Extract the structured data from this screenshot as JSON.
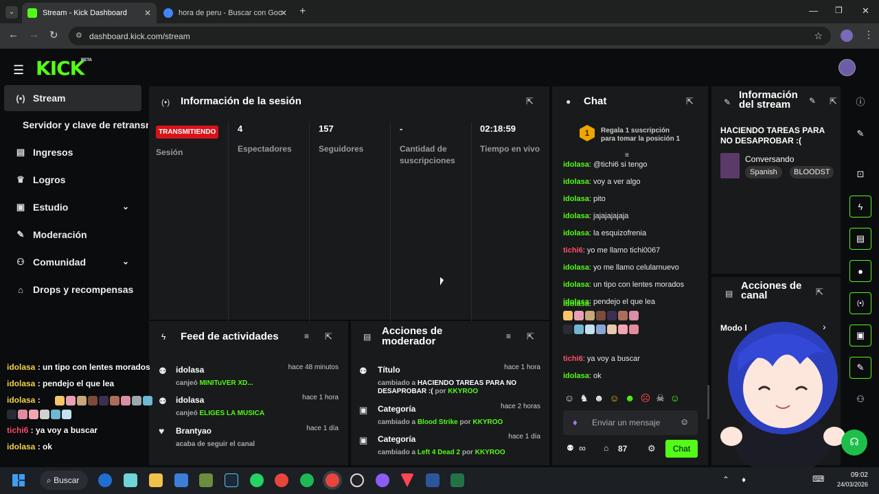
{
  "browser": {
    "tabs": [
      {
        "title": "Stream - Kick Dashboard",
        "active": true
      },
      {
        "title": "hora de peru - Buscar con Goo",
        "active": false
      }
    ],
    "url": "dashboard.kick.com/stream"
  },
  "header": {
    "logo": "KICK",
    "beta": "BETA"
  },
  "sidebar": {
    "items": [
      {
        "label": "Stream",
        "icon": "broadcast-icon",
        "active": true
      },
      {
        "label": "Servidor y clave de retransm",
        "icon": ""
      },
      {
        "label": "Ingresos",
        "icon": "chart-icon"
      },
      {
        "label": "Logros",
        "icon": "trophy-icon"
      },
      {
        "label": "Estudio",
        "icon": "studio-icon"
      },
      {
        "label": "Moderación",
        "icon": "wrench-icon"
      },
      {
        "label": "Comunidad",
        "icon": "community-icon"
      },
      {
        "label": "Drops y recompensas",
        "icon": "gift-icon"
      }
    ]
  },
  "session": {
    "title": "Información de la sesión",
    "status_badge": "TRANSMITIENDO",
    "status_label": "Sesión",
    "stats": [
      {
        "value": "4",
        "label": "Espectadores"
      },
      {
        "value": "157",
        "label": "Seguidores"
      },
      {
        "value": "-",
        "label": "Cantidad de suscripciones"
      },
      {
        "value": "02:18:59",
        "label": "Tiempo en vivo"
      }
    ]
  },
  "feed": {
    "title": "Feed de actividades",
    "items": [
      {
        "name": "idolasa",
        "time": "hace 48 minutos",
        "action": "canjeó",
        "detail": "MINITuVER XD..."
      },
      {
        "name": "idolasa",
        "time": "hace 1 hora",
        "action": "canjeó",
        "detail": "ELIGES LA MUSICA"
      },
      {
        "name": "Brantyao",
        "time": "hace 1 día",
        "action": "acaba de seguir el canal",
        "detail": ""
      }
    ]
  },
  "modactions": {
    "title": "Acciones de moderador",
    "items": [
      {
        "name": "Título",
        "time": "hace 1 hora",
        "prefix": "cambiado a",
        "value": "HACIENDO TAREAS PARA NO DESAPROBAR :(",
        "by": "por",
        "user": "KKYROO"
      },
      {
        "name": "Categoría",
        "time": "hace 2 horas",
        "prefix": "cambiado a",
        "value": "Blood Strike",
        "by": "por",
        "user": "KKYROO"
      },
      {
        "name": "Categoría",
        "time": "hace 1 día",
        "prefix": "cambiado a",
        "value": "Left 4 Dead 2",
        "by": "por",
        "user": "KKYROO"
      }
    ]
  },
  "chat": {
    "title": "Chat",
    "gift_rank": "1",
    "gift_text_1": "Regala 1 suscripción",
    "gift_text_2": "para tomar la posición 1",
    "messages": [
      {
        "user": "idolasa",
        "text": "@tichi6 si tengo"
      },
      {
        "user": "idolasa",
        "text": "voy a ver algo"
      },
      {
        "user": "idolasa",
        "text": "pito"
      },
      {
        "user": "idolasa",
        "text": "jajajajajaja"
      },
      {
        "user": "idolasa",
        "text": "la esquizofrenia"
      },
      {
        "user": "tichi6",
        "text": "yo me llamo tichi0067"
      },
      {
        "user": "idolasa",
        "text": "yo me llamo celularnuevo"
      },
      {
        "user": "idolasa",
        "text": "un tipo con lentes morados"
      },
      {
        "user": "idolasa",
        "text": "pendejo el que lea"
      },
      {
        "user": "idolasa",
        "text": ""
      },
      {
        "user": "tichi6",
        "text": "ya voy a buscar"
      },
      {
        "user": "idolasa",
        "text": "ok"
      }
    ],
    "placeholder": "Enviar un mensaje",
    "points": "87",
    "infinity": "∞",
    "send_label": "Chat"
  },
  "streaminfo": {
    "title_1": "Información",
    "title_2": "del stream",
    "stream_title": "HACIENDO TAREAS PARA NO DESAPROBAR :(",
    "category": "Conversando",
    "tags": [
      "Spanish",
      "BLOODST"
    ]
  },
  "channelactions": {
    "title_1": "Acciones de",
    "title_2": "canal",
    "mode_label": "Modo l"
  },
  "overlay_chat": [
    {
      "user": "idolasa",
      "text": "un tipo con lentes morados"
    },
    {
      "user": "idolasa",
      "text": "pendejo el que lea"
    },
    {
      "user": "idolasa",
      "text": ""
    },
    {
      "user": "tichi6",
      "text": "ya voy a buscar"
    },
    {
      "user": "idolasa",
      "text": "ok"
    }
  ],
  "taskbar": {
    "search_label": "Buscar",
    "time": "09:02",
    "date": "24/03/2026"
  },
  "colors": {
    "accent": "#53fc18",
    "live_red": "#d7141a"
  }
}
